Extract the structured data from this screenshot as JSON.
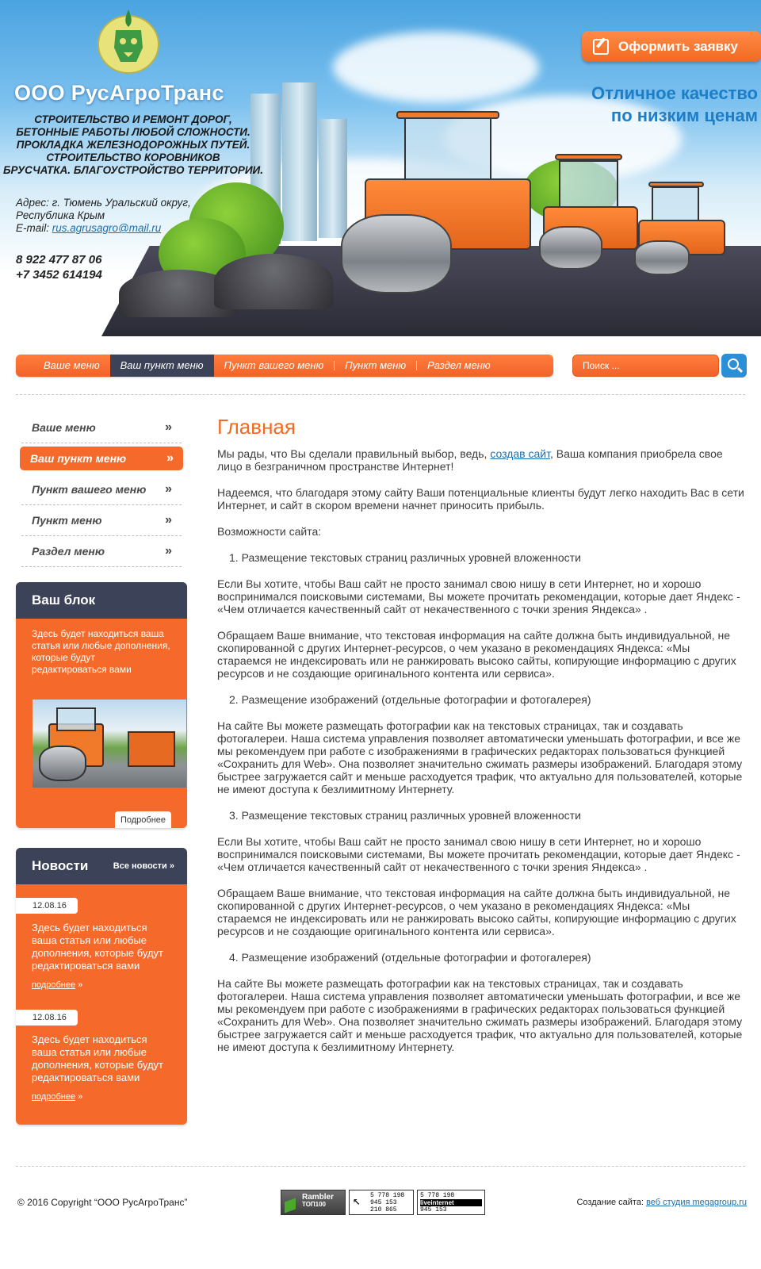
{
  "header": {
    "company": "ООО РусАгроТранс",
    "tagline": [
      "СТРОИТЕЛЬСТВО И РЕМОНТ ДОРОГ,",
      "БЕТОННЫЕ РАБОТЫ ЛЮБОЙ СЛОЖНОСТИ.",
      "ПРОКЛАДКА ЖЕЛЕЗНОДОРОЖНЫХ ПУТЕЙ.",
      "СТРОИТЕЛЬСТВО КОРОВНИКОВ",
      "БРУСЧАТКА. БЛАГОУСТРОЙСТВО ТЕРРИТОРИИ."
    ],
    "address_line1": "Адрес: г. Тюмень Уральский округ,",
    "address_line2": "Республика Крым",
    "email_label": "E-mail: ",
    "email": "rus.agrusagro@mail.ru",
    "phone1": "8 922 477 87 06",
    "phone2": "+7 3452 614194",
    "order_button": "Оформить заявку",
    "slogan_line1": "Отличное качество",
    "slogan_line2": "по низким ценам"
  },
  "nav": {
    "items": [
      "Ваше меню",
      "Ваш пункт меню",
      "Пункт вашего меню",
      "Пункт меню",
      "Раздел меню"
    ],
    "active": 1,
    "search_placeholder": "Поиск ..."
  },
  "sidebar": {
    "menu": [
      "Ваше меню",
      "Ваш пункт меню",
      "Пункт вашего меню",
      "Пункт меню",
      "Раздел меню"
    ],
    "active": 1,
    "block_title": "Ваш блок",
    "block_text": "Здесь будет находиться ваша статья или любые дополнения, которые будут редактироваться вами",
    "block_more": "Подробнее",
    "news_title": "Новости",
    "news_all": "Все новости »",
    "news": [
      {
        "date": "12.08.16",
        "text": "Здесь будет находиться ваша статья или любые дополнения, которые будут редактироваться вами",
        "more": "подробнее"
      },
      {
        "date": "12.08.16",
        "text": "Здесь будет находиться ваша статья или любые дополнения, которые будут редактироваться вами",
        "more": "подробнее"
      }
    ]
  },
  "content": {
    "title": "Главная",
    "p1_before": "Мы рады, что Вы сделали правильный выбор, ведь, ",
    "p1_link": "создав сайт",
    "p1_after": ", Ваша компания приобрела свое лицо в безграничном пространстве Интернет!",
    "p2": "Надеемся, что благодаря этому сайту Ваши потенциальные клиенты будут легко находить Вас в сети Интернет, и сайт в скором времени начнет приносить прибыль.",
    "p3": "Возможности сайта:",
    "li1": "1. Размещение текстовых страниц различных уровней вложенности",
    "p4": "Если Вы хотите, чтобы Ваш сайт не просто занимал свою нишу в сети Интернет, но и хорошо воспринимался поисковыми системами, Вы можете прочитать рекомендации, которые дает Яндекс - «Чем отличается качественный сайт от некачественного с точки зрения Яндекса» .",
    "p5": "Обращаем Ваше внимание, что текстовая информация на сайте должна быть индивидуальной, не скопированной с других Интернет-ресурсов, о чем указано в рекомендациях Яндекса: «Мы стараемся не индексировать или не ранжировать высоко сайты, копирующие информацию с других ресурсов и не создающие оригинального контента или сервиса».",
    "li2": "2. Размещение изображений (отдельные фотографии и фотогалерея)",
    "p6": "На сайте Вы можете размещать фотографии как на текстовых страницах, так и создавать фотогалереи. Наша система управления позволяет автоматически уменьшать фотографии, и все же мы рекомендуем при работе с изображениями в графических редакторах пользоваться функцией «Сохранить для Web». Она позволяет значительно сжимать размеры изображений. Благодаря этому быстрее загружается сайт и меньше расходуется трафик, что актуально для пользователей, которые не имеют доступа к безлимитному Интернету.",
    "li3": "3. Размещение текстовых страниц различных уровней вложенности",
    "p7": "Если Вы хотите, чтобы Ваш сайт не просто занимал свою нишу в сети Интернет, но и хорошо воспринимался поисковыми системами, Вы можете прочитать рекомендации, которые дает Яндекс - «Чем отличается качественный сайт от некачественного с точки зрения Яндекса» .",
    "p8": "Обращаем Ваше внимание, что текстовая информация на сайте должна быть индивидуальной, не скопированной с других Интернет-ресурсов, о чем указано в рекомендациях Яндекса: «Мы стараемся не индексировать или не ранжировать высоко сайты, копирующие информацию с других ресурсов и не создающие оригинального контента или сервиса».",
    "li4": "4. Размещение изображений (отдельные фотографии и фотогалерея)",
    "p9": "На сайте Вы можете размещать фотографии как на текстовых страницах, так и создавать фотогалереи. Наша система управления позволяет автоматически уменьшать фотографии, и все же мы рекомендуем при работе с изображениями в графических редакторах пользоваться функцией «Сохранить для Web». Она позволяет значительно сжимать размеры изображений. Благодаря этому быстрее загружается сайт и меньше расходуется трафик, что актуально для пользователей, которые не имеют доступа к безлимитному Интернету."
  },
  "footer": {
    "copyright": "© 2016 Copyright “ООО РусАгроТранс”",
    "rambler_label": "Rambler",
    "rambler_sub": "ТОП100",
    "counter1": [
      "5 778 198",
      "945 153",
      "210 865"
    ],
    "counter2": [
      "5 778 198",
      "945 153"
    ],
    "liveinternet": "liveinternet",
    "made_label": "Создание сайта: ",
    "made_link": "веб студия megagroup.ru"
  },
  "colors": {
    "accent": "#f56a2a",
    "dark": "#3c4257",
    "blue": "#1c7ec9"
  }
}
